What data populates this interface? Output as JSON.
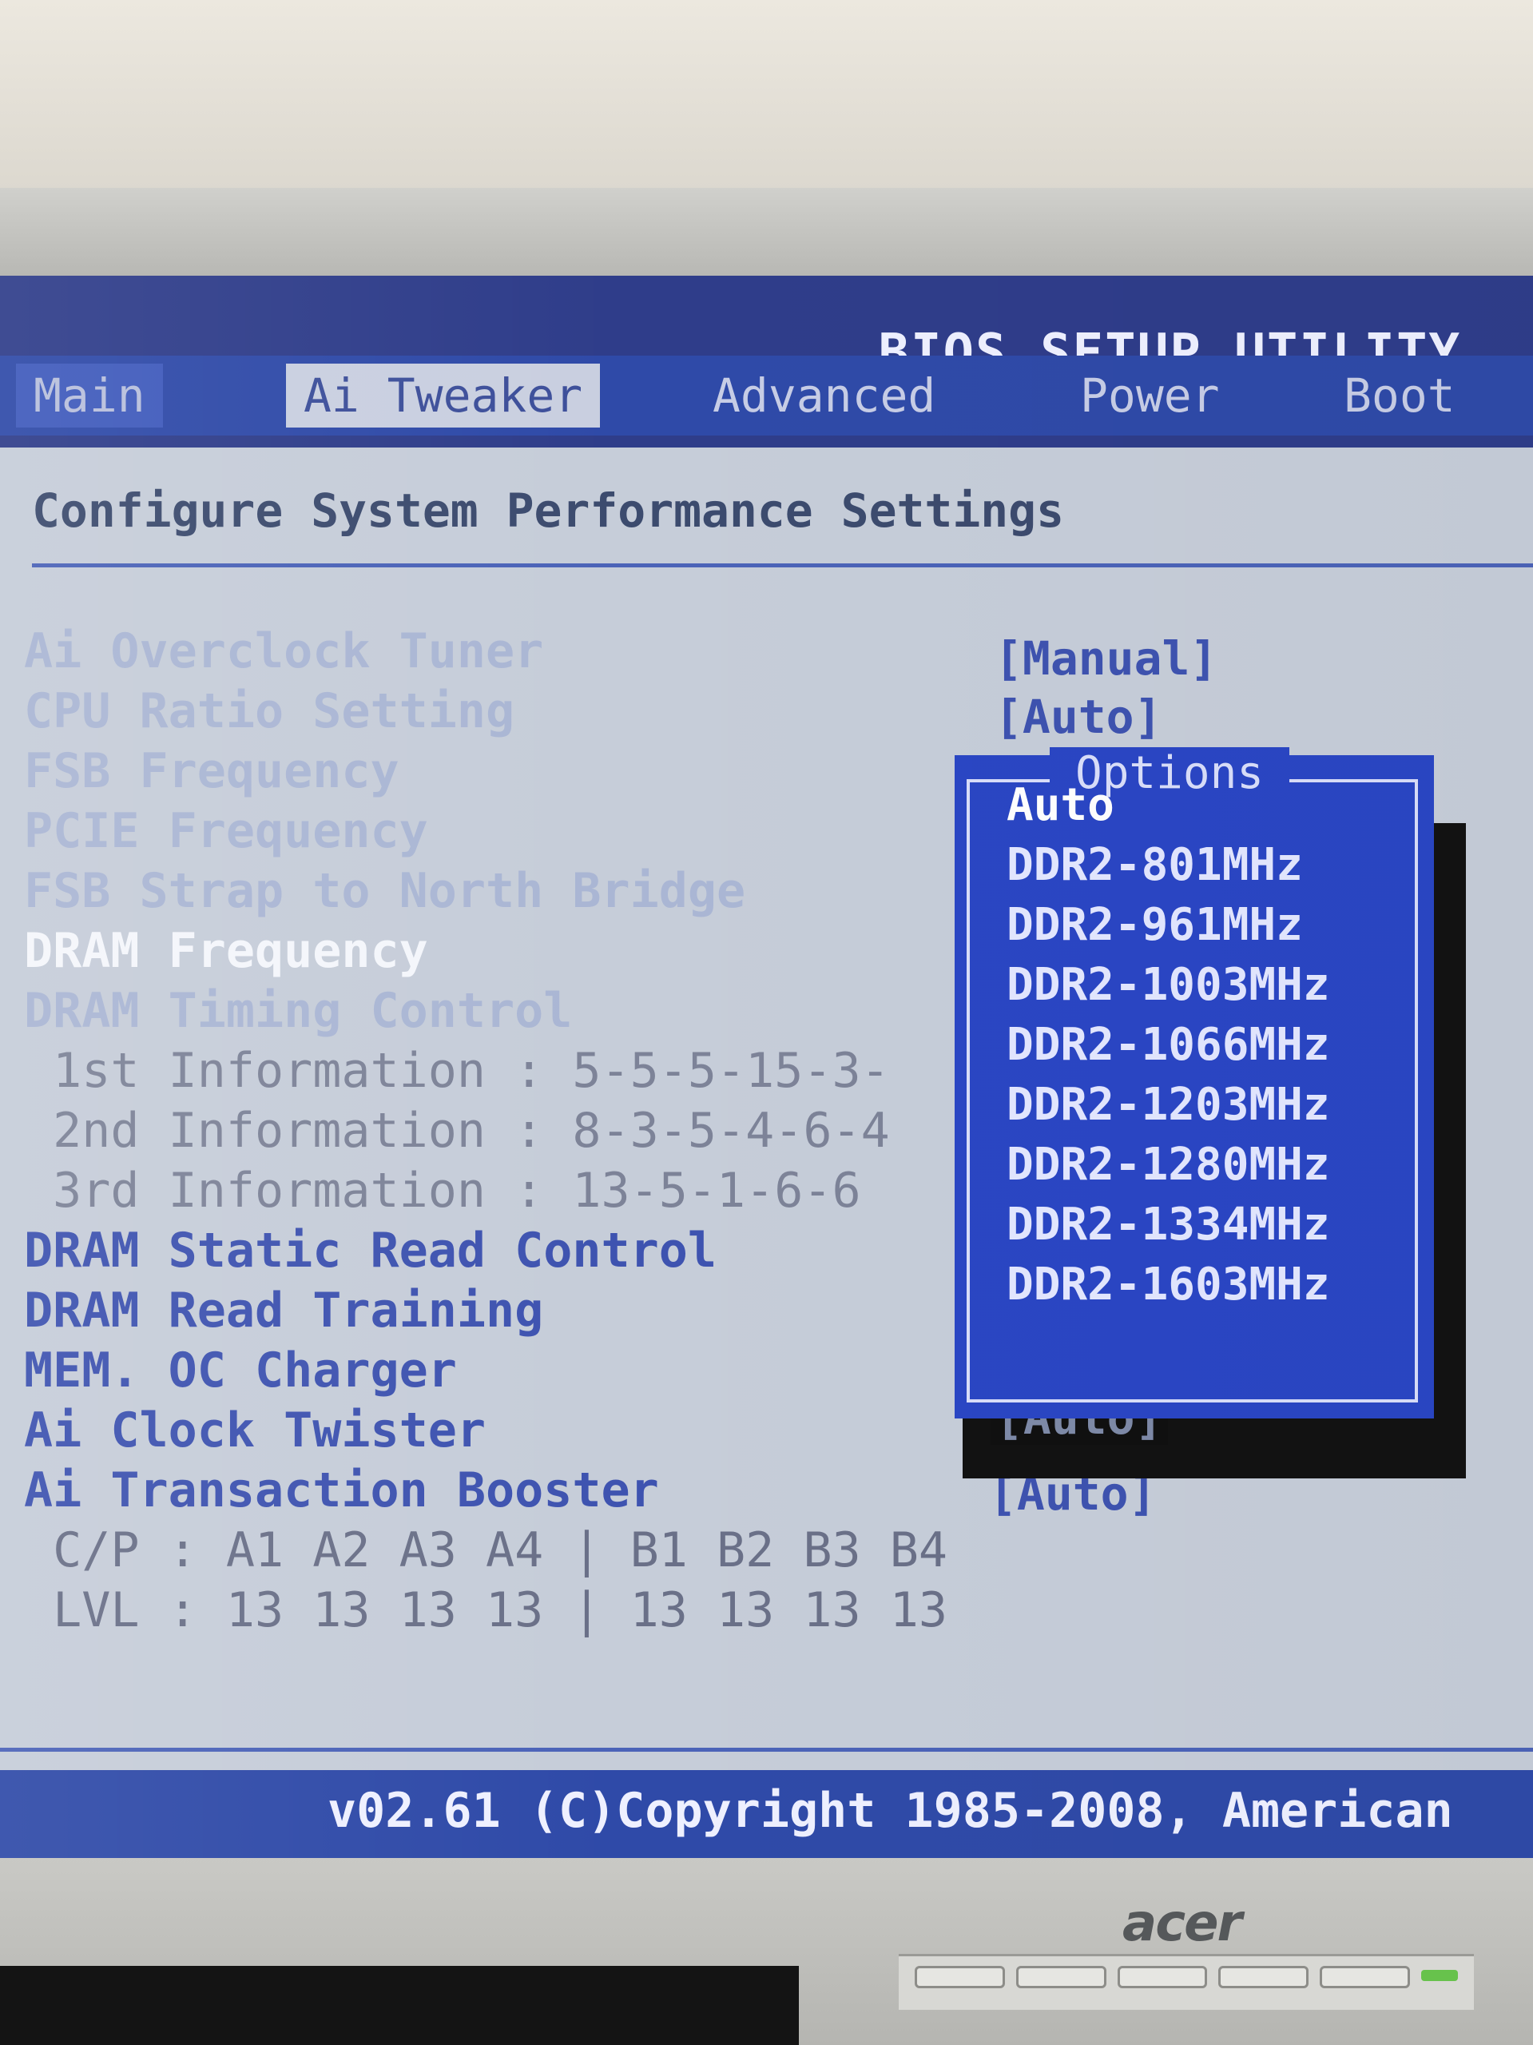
{
  "header": {
    "title": "BIOS SETUP UTILITY"
  },
  "tabs": [
    "Main",
    "Ai Tweaker",
    "Advanced",
    "Power",
    "Boot"
  ],
  "active_tab": "Ai Tweaker",
  "section_title": "Configure System Performance Settings",
  "settings": [
    {
      "label": "Ai Overclock Tuner",
      "value": "[Manual]"
    },
    {
      "label": "CPU Ratio Setting",
      "value": "[Auto]"
    },
    {
      "label": "FSB Frequency"
    },
    {
      "label": "PCIE Frequency"
    },
    {
      "label": "FSB Strap to North Bridge"
    },
    {
      "label": "DRAM Frequency"
    },
    {
      "label": "DRAM Timing Control"
    },
    {
      "label": " 1st Information : 5-5-5-15-3-"
    },
    {
      "label": " 2nd Information : 8-3-5-4-6-4"
    },
    {
      "label": " 3rd Information : 13-5-1-6-6"
    },
    {
      "label": "DRAM Static Read Control"
    },
    {
      "label": "DRAM Read Training"
    },
    {
      "label": "MEM. OC Charger"
    },
    {
      "label": "Ai Clock Twister",
      "value": "[Auto]"
    },
    {
      "label": "Ai Transaction Booster",
      "value": "[Auto]"
    }
  ],
  "cp_line": " C/P : A1 A2 A3 A4 | B1 B2 B3 B4",
  "lvl_line": " LVL : 13 13 13 13 | 13 13 13 13",
  "options_popup": {
    "title": "Options",
    "items": [
      "Auto",
      "DDR2-801MHz",
      "DDR2-961MHz",
      "DDR2-1003MHz",
      "DDR2-1066MHz",
      "DDR2-1203MHz",
      "DDR2-1280MHz",
      "DDR2-1334MHz",
      "DDR2-1603MHz"
    ],
    "selected": "Auto"
  },
  "footer": {
    "text": "v02.61 (C)Copyright 1985-2008, American"
  },
  "monitor": {
    "brand": "acer"
  }
}
